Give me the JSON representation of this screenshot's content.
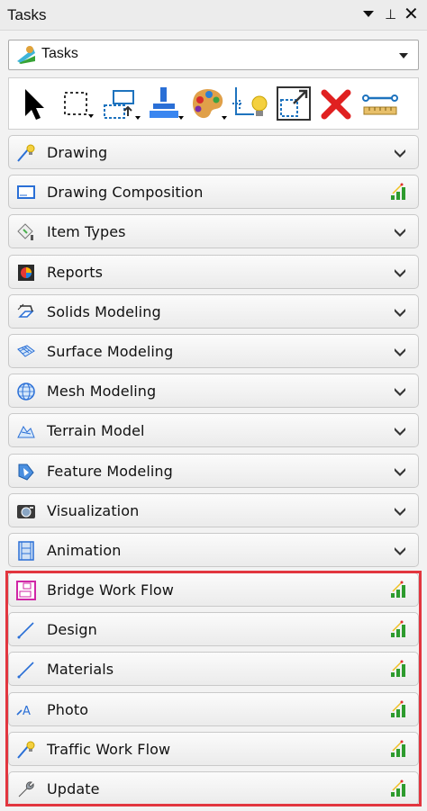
{
  "panel": {
    "title": "Tasks",
    "pin_glyph": "⊥",
    "close_glyph": "✕",
    "menu_icon": "triangle-down-icon"
  },
  "dropdown": {
    "selected": "Tasks",
    "icon": "tasks-workflow-icon"
  },
  "toolbar": {
    "tools": [
      {
        "name": "select-arrow-icon"
      },
      {
        "name": "selection-box-icon"
      },
      {
        "name": "move-rectangle-icon"
      },
      {
        "name": "paint-brush-icon"
      },
      {
        "name": "palette-icon"
      },
      {
        "name": "snap-lightbulb-icon"
      },
      {
        "name": "resize-box-icon"
      },
      {
        "name": "delete-x-icon"
      },
      {
        "name": "measure-ruler-icon"
      }
    ]
  },
  "tasks": [
    {
      "label": "Drawing",
      "indicator": "chevron",
      "icon": "pencil-bulb-icon"
    },
    {
      "label": "Drawing Composition",
      "indicator": "signal",
      "icon": "sheet-icon"
    },
    {
      "label": "Item Types",
      "indicator": "chevron",
      "icon": "tag-icon"
    },
    {
      "label": "Reports",
      "indicator": "chevron",
      "icon": "report-icon"
    },
    {
      "label": "Solids Modeling",
      "indicator": "chevron",
      "icon": "solid-icon"
    },
    {
      "label": "Surface Modeling",
      "indicator": "chevron",
      "icon": "surface-icon"
    },
    {
      "label": "Mesh Modeling",
      "indicator": "chevron",
      "icon": "mesh-globe-icon"
    },
    {
      "label": "Terrain Model",
      "indicator": "chevron",
      "icon": "terrain-icon"
    },
    {
      "label": "Feature Modeling",
      "indicator": "chevron",
      "icon": "feature-icon"
    },
    {
      "label": "Visualization",
      "indicator": "chevron",
      "icon": "camera-icon"
    },
    {
      "label": "Animation",
      "indicator": "chevron",
      "icon": "film-icon"
    },
    {
      "label": "Bridge Work Flow",
      "indicator": "signal",
      "icon": "bridge-icon"
    },
    {
      "label": "Design",
      "indicator": "signal",
      "icon": "line-icon"
    },
    {
      "label": "Materials",
      "indicator": "signal",
      "icon": "line-icon"
    },
    {
      "label": "Photo",
      "indicator": "signal",
      "icon": "photo-a-icon"
    },
    {
      "label": "Traffic Work Flow",
      "indicator": "signal",
      "icon": "pencil-bulb-icon"
    },
    {
      "label": "Update",
      "indicator": "signal",
      "icon": "wrench-icon"
    }
  ],
  "colors": {
    "highlight": "#e2363f",
    "signal_green": "#2e9b2e"
  }
}
